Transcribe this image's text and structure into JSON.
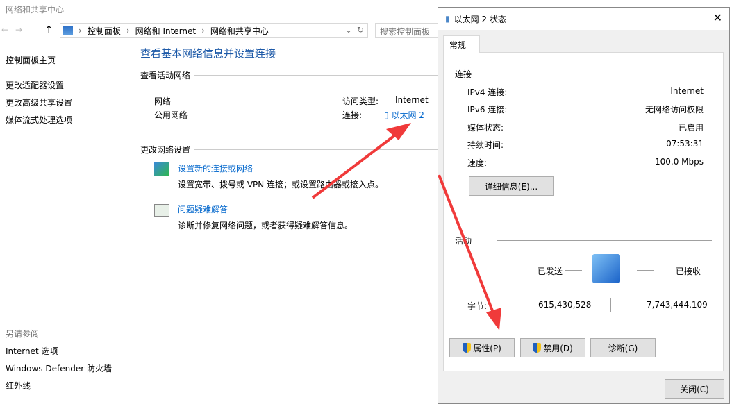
{
  "window": {
    "title": "网络和共享中心",
    "breadcrumb": [
      "控制面板",
      "网络和 Internet",
      "网络和共享中心"
    ],
    "search_placeholder": "搜索控制面板"
  },
  "sidebar": {
    "items": [
      "控制面板主页",
      "更改适配器设置",
      "更改高级共享设置",
      "媒体流式处理选项"
    ],
    "see_also_label": "另请参阅",
    "see_also": [
      "Internet 选项",
      "Windows Defender 防火墙",
      "红外线"
    ]
  },
  "main": {
    "heading": "查看基本网络信息并设置连接",
    "active_label": "查看活动网络",
    "network_name": "网络",
    "network_type": "公用网络",
    "access_type_label": "访问类型:",
    "access_type": "Internet",
    "connection_label": "连接:",
    "connection_link": "以太网 2",
    "change_label": "更改网络设置",
    "tasks": [
      {
        "title": "设置新的连接或网络",
        "desc": "设置宽带、拨号或 VPN 连接；或设置路由器或接入点。"
      },
      {
        "title": "问题疑难解答",
        "desc": "诊断并修复网络问题，或者获得疑难解答信息。"
      }
    ]
  },
  "dialog": {
    "title": "以太网 2 状态",
    "tab": "常规",
    "connection_section": "连接",
    "rows": [
      {
        "label": "IPv4 连接:",
        "value": "Internet"
      },
      {
        "label": "IPv6 连接:",
        "value": "无网络访问权限"
      },
      {
        "label": "媒体状态:",
        "value": "已启用"
      },
      {
        "label": "持续时间:",
        "value": "07:53:31"
      },
      {
        "label": "速度:",
        "value": "100.0 Mbps"
      }
    ],
    "details_button": "详细信息(E)...",
    "activity_section": "活动",
    "sent_label": "已发送",
    "received_label": "已接收",
    "bytes_label": "字节:",
    "bytes_sent": "615,430,528",
    "bytes_received": "7,743,444,109",
    "properties_button": "属性(P)",
    "disable_button": "禁用(D)",
    "diagnose_button": "诊断(G)",
    "close_button": "关闭(C)"
  },
  "annotation_color": "#f03a3a"
}
